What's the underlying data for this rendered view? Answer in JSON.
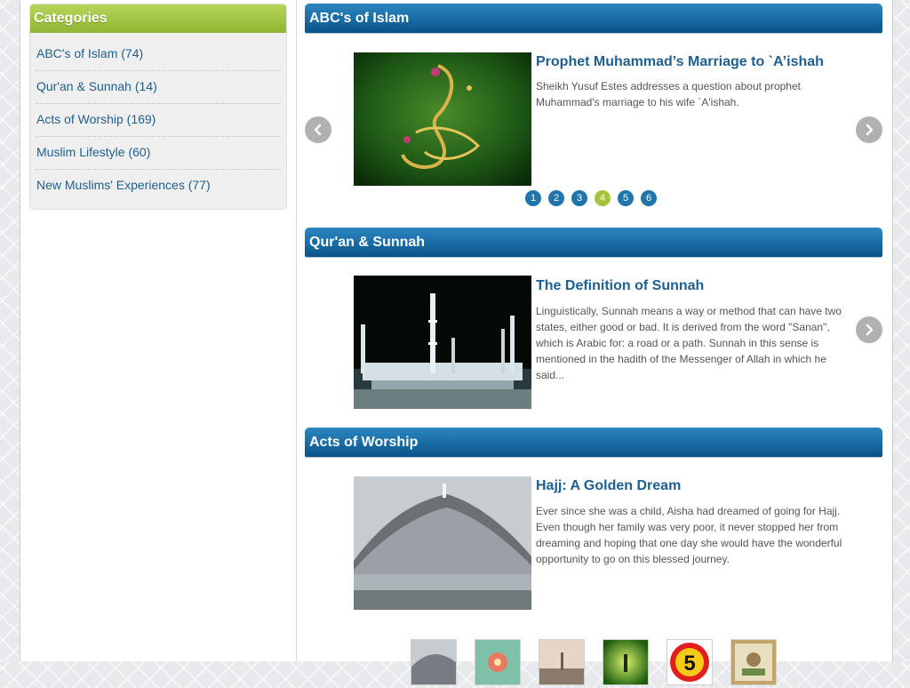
{
  "sidebar": {
    "title": "Categories",
    "items": [
      {
        "label": "ABC's of Islam (74)"
      },
      {
        "label": "Qur'an & Sunnah (14)"
      },
      {
        "label": "Acts of Worship (169)"
      },
      {
        "label": "Muslim Lifestyle (60)"
      },
      {
        "label": "New Muslims' Experiences (77)"
      }
    ]
  },
  "sections": [
    {
      "title": "ABC's of Islam",
      "article": {
        "title": "Prophet Muhammad’s Marriage to `A’ishah",
        "desc": "Sheikh Yusuf Estes addresses a question about prophet Muhammad's marriage to his wife `A'ishah."
      },
      "pager": [
        "1",
        "2",
        "3",
        "4",
        "5",
        "6"
      ],
      "active_page": "4"
    },
    {
      "title": "Qur'an & Sunnah",
      "article": {
        "title": "The Definition of Sunnah",
        "desc": "Linguistically, Sunnah means a way or method that can have two states, either good or bad. It is derived from the word \"Sanan\", which is Arabic for: a road or a path. Sunnah in this sense is mentioned in the hadith of the Messenger of Allah in which he said..."
      }
    },
    {
      "title": "Acts of Worship",
      "article": {
        "title": "Hajj: A Golden Dream",
        "desc": "Ever since she was a child, Aisha had dreamed of going for Hajj. Even though her family was very poor, it never stopped her from dreaming and hoping that one day she would have the wonderful opportunity to go on this blessed journey."
      },
      "thumb_badge": "5"
    }
  ],
  "icons": {
    "prev": "chevron-left-icon",
    "next": "chevron-right-icon"
  },
  "colors": {
    "accent_blue": "#1a6ea7",
    "accent_green": "#8fb531",
    "link": "#1e5f91"
  }
}
